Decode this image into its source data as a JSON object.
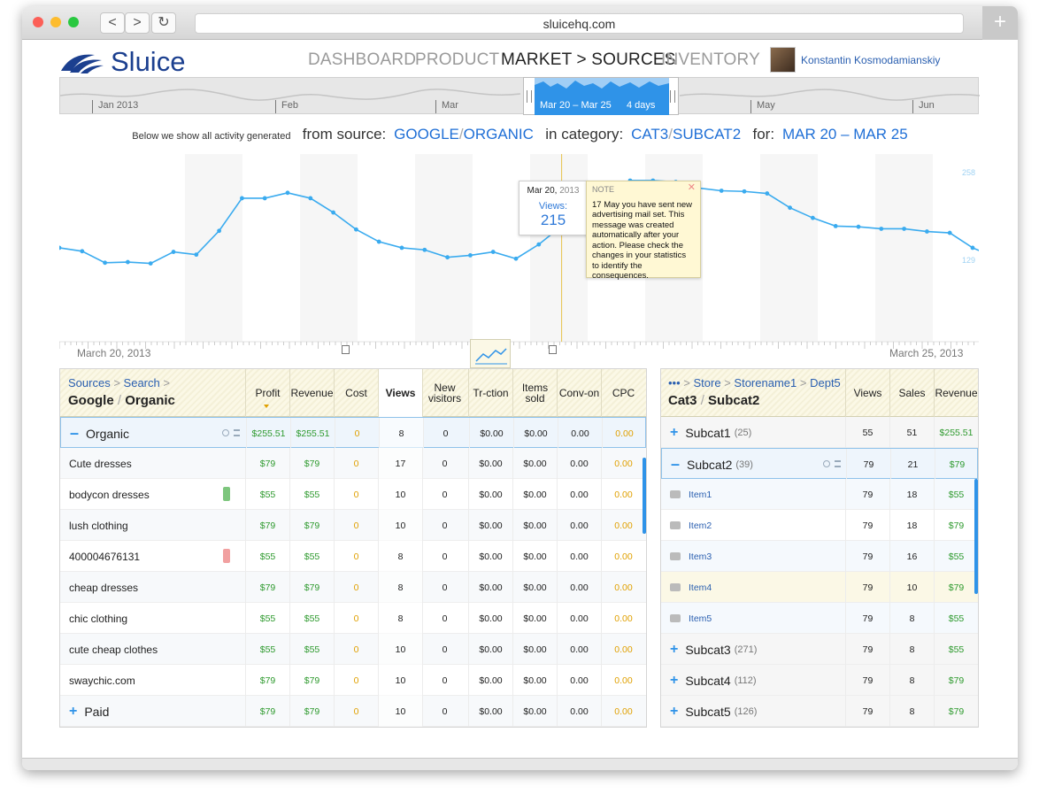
{
  "browser": {
    "url": "sluicehq.com",
    "back": "<",
    "forward": ">",
    "reload": "↻",
    "new_tab": "+"
  },
  "app": {
    "brand": "Sluice"
  },
  "nav": [
    {
      "label": "DASHBOARD",
      "active": false
    },
    {
      "label": "PRODUCT",
      "active": false
    },
    {
      "label": "MARKET > SOURCES",
      "active": true
    },
    {
      "label": "INVENTORY",
      "active": false
    }
  ],
  "user": {
    "name": "Konstantin Kosmodamianskiy"
  },
  "timeline": {
    "months": [
      "Jan 2013",
      "Feb",
      "Mar",
      "May",
      "Jun"
    ],
    "selection": "Mar 20 – Mar 25",
    "selection_days": "4 days"
  },
  "filter": {
    "intro": "Below we show all activity generated",
    "from_label": "from source:",
    "source1": "GOOGLE",
    "source2": "ORGANIC",
    "category_label": "in category:",
    "cat1": "CAT3",
    "cat2": "SUBCAT2",
    "for_label": "for:",
    "range": "MAR 20 – MAR 25",
    "sep": "/"
  },
  "chart_data": {
    "type": "line",
    "series": [
      {
        "values": [
          146,
          141,
          124,
          125,
          123,
          140,
          136,
          171,
          219,
          219,
          227,
          219,
          198,
          173,
          155,
          146,
          143,
          132,
          135,
          140,
          130,
          151,
          178,
          195,
          215,
          245,
          245,
          243,
          234,
          230,
          229,
          226,
          205,
          190,
          178,
          177,
          174,
          174,
          170,
          168,
          146,
          132
        ]
      }
    ],
    "y_ticks": [
      "258",
      "129"
    ],
    "x_start": "March 20, 2013",
    "x_end": "March 25, 2013",
    "grid": true,
    "color": "#3aabef",
    "cursor_color": "#e8c24a"
  },
  "tooltip": {
    "date": "Mar 20, 2013",
    "date_day": "Mar 20,",
    "date_year": "2013",
    "label": "Views:",
    "value": "215"
  },
  "note": {
    "title": "NOTE",
    "close": "✕",
    "text": "17 May you have sent new advertising mail set. This message was created automatically after your action. Please check the changes in your statistics to identify the consequences."
  },
  "left_table": {
    "crumb1": "Sources",
    "crumb2": "Search",
    "title1": "Google",
    "title2": "Organic",
    "columns": [
      "Profit",
      "Revenue",
      "Cost",
      "Views",
      "New visitors",
      "Tr-ction",
      "Items sold",
      "Conv-on",
      "CPC"
    ],
    "group": {
      "name": "Organic",
      "values": [
        "$255.51",
        "$255.51",
        "0",
        "8",
        "0",
        "$0.00",
        "$0.00",
        "0.00",
        "0.00"
      ]
    },
    "rows": [
      {
        "name": "Cute dresses",
        "values": [
          "$79",
          "$79",
          "0",
          "17",
          "0",
          "$0.00",
          "$0.00",
          "0.00",
          "0.00"
        ]
      },
      {
        "name": "bodycon dresses",
        "values": [
          "$55",
          "$55",
          "0",
          "10",
          "0",
          "$0.00",
          "$0.00",
          "0.00",
          "0.00"
        ]
      },
      {
        "name": "lush clothing",
        "values": [
          "$79",
          "$79",
          "0",
          "10",
          "0",
          "$0.00",
          "$0.00",
          "0.00",
          "0.00"
        ]
      },
      {
        "name": "400004676131",
        "values": [
          "$55",
          "$55",
          "0",
          "8",
          "0",
          "$0.00",
          "$0.00",
          "0.00",
          "0.00"
        ]
      },
      {
        "name": "cheap dresses",
        "values": [
          "$79",
          "$79",
          "0",
          "8",
          "0",
          "$0.00",
          "$0.00",
          "0.00",
          "0.00"
        ]
      },
      {
        "name": "chic clothing",
        "values": [
          "$55",
          "$55",
          "0",
          "8",
          "0",
          "$0.00",
          "$0.00",
          "0.00",
          "0.00"
        ]
      },
      {
        "name": "cute cheap clothes",
        "values": [
          "$55",
          "$55",
          "0",
          "10",
          "0",
          "$0.00",
          "$0.00",
          "0.00",
          "0.00"
        ]
      },
      {
        "name": "swaychic.com",
        "values": [
          "$79",
          "$79",
          "0",
          "10",
          "0",
          "$0.00",
          "$0.00",
          "0.00",
          "0.00"
        ]
      }
    ],
    "paid": {
      "name": "Paid",
      "values": [
        "$79",
        "$79",
        "0",
        "10",
        "0",
        "$0.00",
        "$0.00",
        "0.00",
        "0.00"
      ]
    }
  },
  "right_table": {
    "crumb0": "•••",
    "crumb1": "Store",
    "crumb2": "Storename1",
    "crumb3": "Dept5",
    "title1": "Cat3",
    "title2": "Subcat2",
    "columns": [
      "Views",
      "Sales",
      "Revenue"
    ],
    "rows": [
      {
        "kind": "group",
        "name": "Subcat1",
        "count": "(25)",
        "values": [
          "55",
          "51",
          "$255.51"
        ]
      },
      {
        "kind": "open",
        "name": "Subcat2",
        "count": "(39)",
        "values": [
          "79",
          "21",
          "$79"
        ]
      },
      {
        "kind": "item",
        "name": "Item1",
        "values": [
          "79",
          "18",
          "$55"
        ]
      },
      {
        "kind": "item",
        "name": "Item2",
        "values": [
          "79",
          "18",
          "$79"
        ]
      },
      {
        "kind": "item",
        "name": "Item3",
        "values": [
          "79",
          "16",
          "$55"
        ]
      },
      {
        "kind": "item",
        "name": "Item4",
        "values": [
          "79",
          "10",
          "$79"
        ]
      },
      {
        "kind": "item",
        "name": "Item5",
        "values": [
          "79",
          "8",
          "$55"
        ]
      },
      {
        "kind": "group",
        "name": "Subcat3",
        "count": "(271)",
        "values": [
          "79",
          "8",
          "$55"
        ]
      },
      {
        "kind": "group",
        "name": "Subcat4",
        "count": "(112)",
        "values": [
          "79",
          "8",
          "$79"
        ]
      },
      {
        "kind": "group",
        "name": "Subcat5",
        "count": "(126)",
        "values": [
          "79",
          "8",
          "$79"
        ]
      }
    ]
  }
}
